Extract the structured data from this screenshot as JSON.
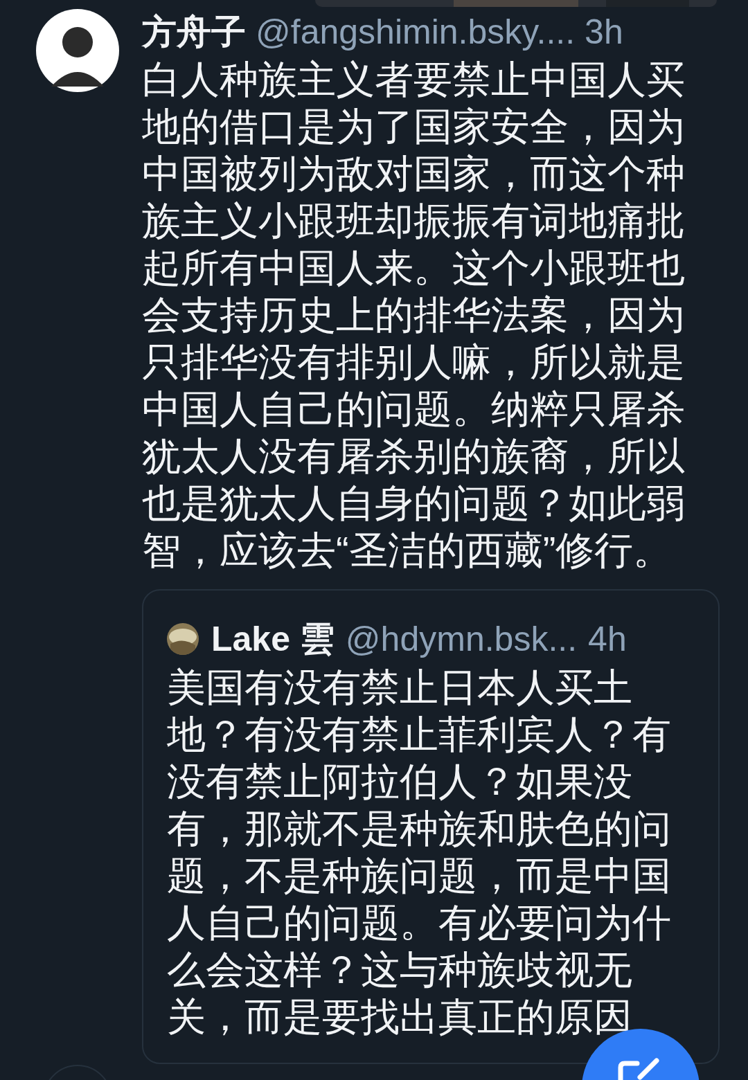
{
  "post": {
    "author_name": "方舟子",
    "handle": "@fangshimin.bsky....",
    "time": "3h",
    "text": "白人种族主义者要禁止中国人买地的借口是为了国家安全，因为中国被列为敌对国家，而这个种族主义小跟班却振振有词地痛批起所有中国人来。这个小跟班也会支持历史上的排华法案，因为只排华没有排别人嘛，所以就是中国人自己的问题。纳粹只屠杀犹太人没有屠杀别的族裔，所以也是犹太人自身的问题？如此弱智，应该去“圣洁的西藏”修行。",
    "quoted_post": {
      "author_name": "Lake 雲",
      "handle": "@hdymn.bsk...",
      "time": "4h",
      "text": "美国有没有禁止日本人买土地？有没有禁止菲利宾人？有没有禁止阿拉伯人？如果没有，那就不是种族和肤色的问题，不是种族问题，而是中国人自己的问题。有必要问为什么会这样？这与种族歧视无关，而是要找出真正的原因"
    }
  }
}
